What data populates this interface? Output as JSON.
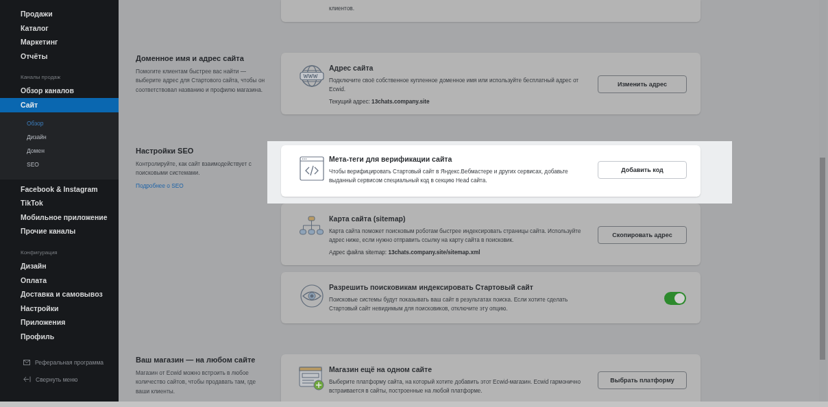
{
  "sidebar": {
    "items": [
      {
        "kind": "link",
        "label": "Продажи",
        "selected": false
      },
      {
        "kind": "link",
        "label": "Каталог",
        "selected": false
      },
      {
        "kind": "link",
        "label": "Маркетинг",
        "selected": false
      },
      {
        "kind": "link",
        "label": "Отчёты",
        "selected": false
      },
      {
        "kind": "header",
        "label": "Каналы продаж"
      },
      {
        "kind": "link",
        "label": "Обзор каналов",
        "selected": false
      },
      {
        "kind": "link",
        "label": "Сайт",
        "selected": true,
        "children": [
          {
            "label": "Обзор",
            "selected": true
          },
          {
            "label": "Дизайн",
            "selected": false
          },
          {
            "label": "Домен",
            "selected": false
          },
          {
            "label": "SEO",
            "selected": false
          }
        ]
      },
      {
        "kind": "link",
        "label": "Facebook & Instagram",
        "selected": false
      },
      {
        "kind": "link",
        "label": "TikTok",
        "selected": false
      },
      {
        "kind": "link",
        "label": "Мобильное приложение",
        "selected": false
      },
      {
        "kind": "link",
        "label": "Прочие каналы",
        "selected": false
      },
      {
        "kind": "header",
        "label": "Конфигурация"
      },
      {
        "kind": "link",
        "label": "Дизайн",
        "selected": false
      },
      {
        "kind": "link",
        "label": "Оплата",
        "selected": false
      },
      {
        "kind": "link",
        "label": "Доставка и самовывоз",
        "selected": false
      },
      {
        "kind": "link",
        "label": "Настройки",
        "selected": false
      },
      {
        "kind": "link",
        "label": "Приложения",
        "selected": false
      },
      {
        "kind": "link",
        "label": "Профиль",
        "selected": false
      }
    ],
    "footer": [
      {
        "kind": "mail",
        "label": "Реферальная программа"
      },
      {
        "kind": "collapse",
        "label": "Свернуть меню"
      }
    ]
  },
  "sections": [
    {
      "cards": [
        {
          "highlighted": false,
          "text": "клиентов."
        }
      ]
    },
    {
      "title": "Доменное имя и адрес сайта",
      "description": "Помогите клиентам быстрее вас найти — выберите адрес для Стартового сайта, чтобы он соответствовал названию и профилю магазина.",
      "cards": [
        {
          "kind": "globe",
          "highlighted": false,
          "title": "Адрес сайта",
          "text": "Подключите своё собственное купленное доменное имя или используйте бесплатный адрес от Ecwid.",
          "detail": "Текущий адрес: **13chats.company.site**",
          "button": "Изменить адрес"
        }
      ]
    },
    {
      "title": "Настройки SEO",
      "description": "Контролируйте, как сайт взаимодействует с поисковыми системами.",
      "link": "Подробнее о SEO",
      "cards": [
        {
          "kind": "code",
          "highlighted": true,
          "title": "Мета-теги для верификации сайта",
          "text": "Чтобы верифицировать Стартовый сайт в Яндекс.Вебмастере и других сервисах, добавьте выданный сервисом специальный код в секцию Head сайта.",
          "button": "Добавить код"
        },
        {
          "kind": "sitemap",
          "highlighted": false,
          "title": "Карта сайта (sitemap)",
          "text": "Карта сайта поможет поисковым роботам быстрее индексировать страницы сайта. Используйте адрес ниже, если нужно отправить ссылку на карту сайта в поисковик.",
          "detail": "Адрес файла sitemap: **13chats.company.site/sitemap.xml**",
          "button": "Скопировать адрес"
        },
        {
          "kind": "eye",
          "highlighted": false,
          "title": "Разрешить поисковикам индексировать Стартовый сайт",
          "text": "Поисковые системы будут показывать ваш сайт в результатах поиска. Если хотите сделать Стартовый сайт невидимым для поисковиков, отключите эту опцию.",
          "toggle": {
            "on": true
          }
        }
      ]
    },
    {
      "title": "Ваш магазин — на любом сайте",
      "description": "Магазин от Ecwid можно встроить в любое количество сайтов, чтобы продавать там, где ваши клиенты.",
      "cards": [
        {
          "kind": "store",
          "highlighted": false,
          "title": "Магазин ещё на одном сайте",
          "text": "Выберите платформу сайта, на который хотите добавить этот Ecwid-магазин. Ecwid гармонично встраивается в сайты, построенные на любой платформе.",
          "button": "Выбрать платформу"
        }
      ]
    }
  ]
}
